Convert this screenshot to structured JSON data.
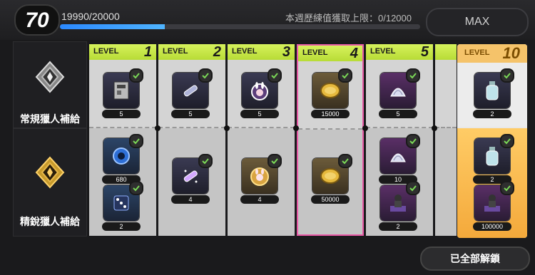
{
  "level": "70",
  "xp": {
    "text": "19990/20000",
    "progress": 0.2904
  },
  "weekly_limit": "本週歷練值獲取上限：0/12000",
  "max_button": "MAX",
  "rows": [
    {
      "label": "常規獵人補給",
      "icon": "silver-crest-icon"
    },
    {
      "label": "精銳獵人補給",
      "icon": "gold-crest-icon"
    }
  ],
  "levels": [
    {
      "text": "LEVEL",
      "num": "1",
      "top": [
        {
          "qty": "5",
          "icon": "id-card-icon"
        }
      ],
      "bottom": [
        {
          "qty": "680",
          "icon": "blue-orb-icon"
        },
        {
          "qty": "2",
          "icon": "dice-icon"
        }
      ]
    },
    {
      "text": "LEVEL",
      "num": "2",
      "top": [
        {
          "qty": "5",
          "icon": "tube-icon"
        }
      ],
      "bottom": [
        {
          "qty": "4",
          "icon": "sparkle-tube-icon"
        }
      ]
    },
    {
      "text": "LEVEL",
      "num": "3",
      "top": [
        {
          "qty": "5",
          "icon": "rabbit-badge-icon"
        }
      ],
      "bottom": [
        {
          "qty": "4",
          "icon": "rabbit-coin-icon"
        }
      ]
    },
    {
      "text": "LEVEL",
      "num": "4",
      "top": [
        {
          "qty": "15000",
          "icon": "coin-icon"
        }
      ],
      "bottom": [
        {
          "qty": "50000",
          "icon": "coin-icon"
        }
      ]
    },
    {
      "text": "LEVEL",
      "num": "5",
      "top": [
        {
          "qty": "5",
          "icon": "shell-icon"
        }
      ],
      "bottom": [
        {
          "qty": "10",
          "icon": "shell-icon"
        },
        {
          "qty": "2",
          "icon": "figure-icon"
        }
      ]
    },
    {
      "text": "LEVEL",
      "num": "10",
      "top": [
        {
          "qty": "2",
          "icon": "bottle-icon"
        }
      ],
      "bottom": [
        {
          "qty": "2",
          "icon": "bottle-icon"
        },
        {
          "qty": "100000",
          "icon": "figure-icon"
        }
      ]
    }
  ],
  "unlock_all_button": "已全部解鎖",
  "colors": {
    "accent_green": "#c7e84a",
    "highlight_pink": "#e85aa6",
    "premium_gold": "#f4a93b",
    "xp_blue": "#2b89ff"
  }
}
